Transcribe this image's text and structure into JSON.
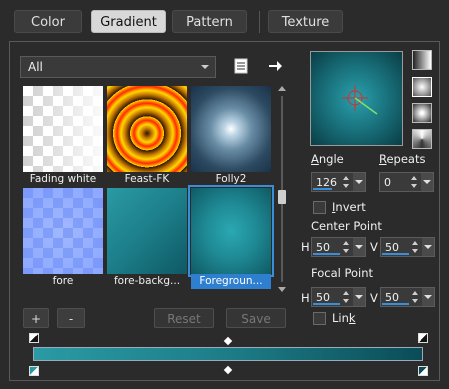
{
  "tabs": [
    {
      "label": "Color",
      "active": false
    },
    {
      "label": "Gradient",
      "active": true
    },
    {
      "label": "Pattern",
      "active": false
    },
    {
      "label": "Texture",
      "active": false
    }
  ],
  "library": {
    "filter_value": "All",
    "items": [
      {
        "name": "Fading white",
        "icon": "fading-white-gradient"
      },
      {
        "name": "Feast-FK",
        "icon": "feast-fk-gradient"
      },
      {
        "name": "Folly2",
        "icon": "folly2-gradient"
      },
      {
        "name": "fore",
        "icon": "fore-gradient"
      },
      {
        "name": "fore-backg...",
        "icon": "fore-background-gradient"
      },
      {
        "name": "Foregroun...",
        "icon": "foreground-gradient",
        "selected": true
      }
    ]
  },
  "buttons": {
    "add": "+",
    "remove": "-",
    "reset": "Reset",
    "save": "Save"
  },
  "angle": {
    "label_prefix": "A",
    "label_rest": "ngle",
    "value": "126",
    "fill": 0.35
  },
  "repeats": {
    "label_prefix": "R",
    "label_rest": "epeats",
    "value": "0",
    "fill": 0.0
  },
  "invert": {
    "label_prefix": "I",
    "label_rest": "nvert",
    "checked": false
  },
  "center_point": {
    "title": "Center Point",
    "h_label": "H",
    "h_value": "50",
    "v_label": "V",
    "v_value": "50",
    "fill": 0.5
  },
  "focal_point": {
    "title": "Focal Point",
    "h_label": "H",
    "h_value": "50",
    "v_label": "V",
    "v_value": "50",
    "fill": 0.5
  },
  "link": {
    "label_prefix": "Lin",
    "label_rest": "k",
    "checked": false
  },
  "colors": {
    "accent": "#3a8ed8",
    "gradient_start": "#2a9aa4",
    "gradient_end": "#0b4c57"
  }
}
